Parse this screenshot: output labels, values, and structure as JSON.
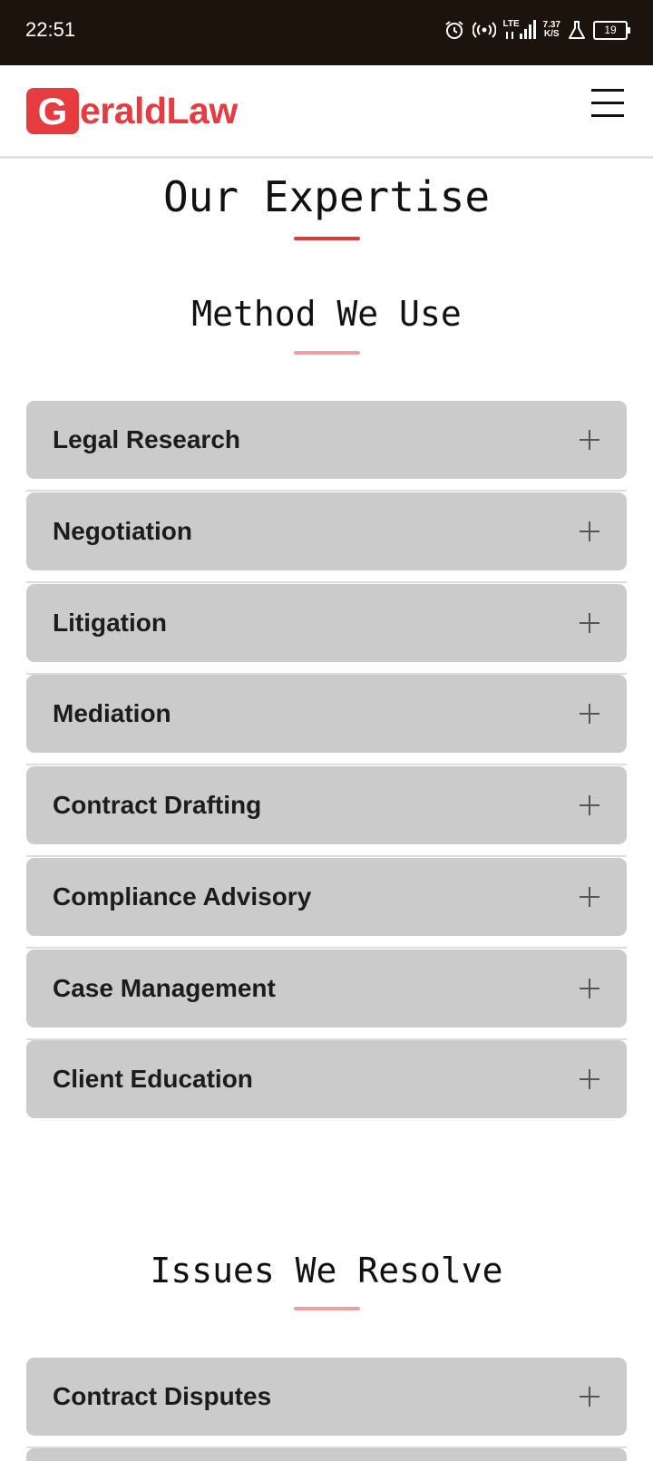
{
  "status_bar": {
    "time": "22:51",
    "network_speed_value": "7.37",
    "network_speed_unit": "K/S",
    "lte_label": "LTE",
    "battery": "19",
    "icons": [
      "alarm-icon",
      "hotspot-icon",
      "signal-icon",
      "lab-icon",
      "battery-icon"
    ]
  },
  "header": {
    "logo_letter": "G",
    "logo_text": "eraldLaw",
    "menu_icon": "hamburger-icon"
  },
  "colors": {
    "brand": "#e63b3f",
    "status_bar_bg": "#1b130c",
    "accordion_bg": "#cbcbcb",
    "underline_primary": "#e0393d",
    "underline_secondary": "#ef9fa1"
  },
  "expertise": {
    "title": "Our Expertise"
  },
  "methods": {
    "title": "Method We Use",
    "items": [
      {
        "label": "Legal Research"
      },
      {
        "label": "Negotiation"
      },
      {
        "label": "Litigation"
      },
      {
        "label": "Mediation"
      },
      {
        "label": "Contract Drafting"
      },
      {
        "label": "Compliance Advisory"
      },
      {
        "label": "Case Management"
      },
      {
        "label": "Client Education"
      }
    ]
  },
  "issues": {
    "title": "Issues We Resolve",
    "items": [
      {
        "label": "Contract Disputes"
      },
      {
        "label": ""
      }
    ]
  }
}
